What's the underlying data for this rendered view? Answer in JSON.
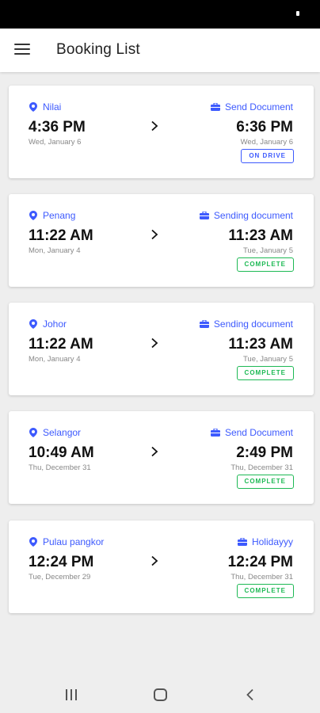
{
  "app_bar": {
    "title": "Booking List",
    "menu_icon": "hamburger-menu-icon"
  },
  "bookings": [
    {
      "from_location": "Nilai",
      "service": "Send Document",
      "start_time": "4:36 PM",
      "start_date": "Wed, January 6",
      "end_time": "6:36 PM",
      "end_date": "Wed, January 6",
      "status": "ON DRIVE",
      "status_color": "#3d5afe"
    },
    {
      "from_location": "Penang",
      "service": "Sending document",
      "start_time": "11:22 AM",
      "start_date": "Mon, January 4",
      "end_time": "11:23 AM",
      "end_date": "Tue, January 5",
      "status": "COMPLETE",
      "status_color": "#1db954"
    },
    {
      "from_location": "Johor",
      "service": "Sending document",
      "start_time": "11:22 AM",
      "start_date": "Mon, January 4",
      "end_time": "11:23 AM",
      "end_date": "Tue, January 5",
      "status": "COMPLETE",
      "status_color": "#1db954"
    },
    {
      "from_location": "Selangor",
      "service": "Send Document",
      "start_time": "10:49 AM",
      "start_date": "Thu, December 31",
      "end_time": "2:49 PM",
      "end_date": "Thu, December 31",
      "status": "COMPLETE",
      "status_color": "#1db954"
    },
    {
      "from_location": "Pulau pangkor",
      "service": "Holidayyy",
      "start_time": "12:24 PM",
      "start_date": "Tue, December 29",
      "end_time": "12:24 PM",
      "end_date": "Thu, December 31",
      "status": "COMPLETE",
      "status_color": "#1db954"
    }
  ],
  "colors": {
    "accent": "#3d5afe",
    "complete": "#1db954",
    "background": "#eeeeee"
  },
  "nav": {
    "recent_icon": "recent-apps-icon",
    "home_icon": "home-icon",
    "back_icon": "back-icon"
  }
}
